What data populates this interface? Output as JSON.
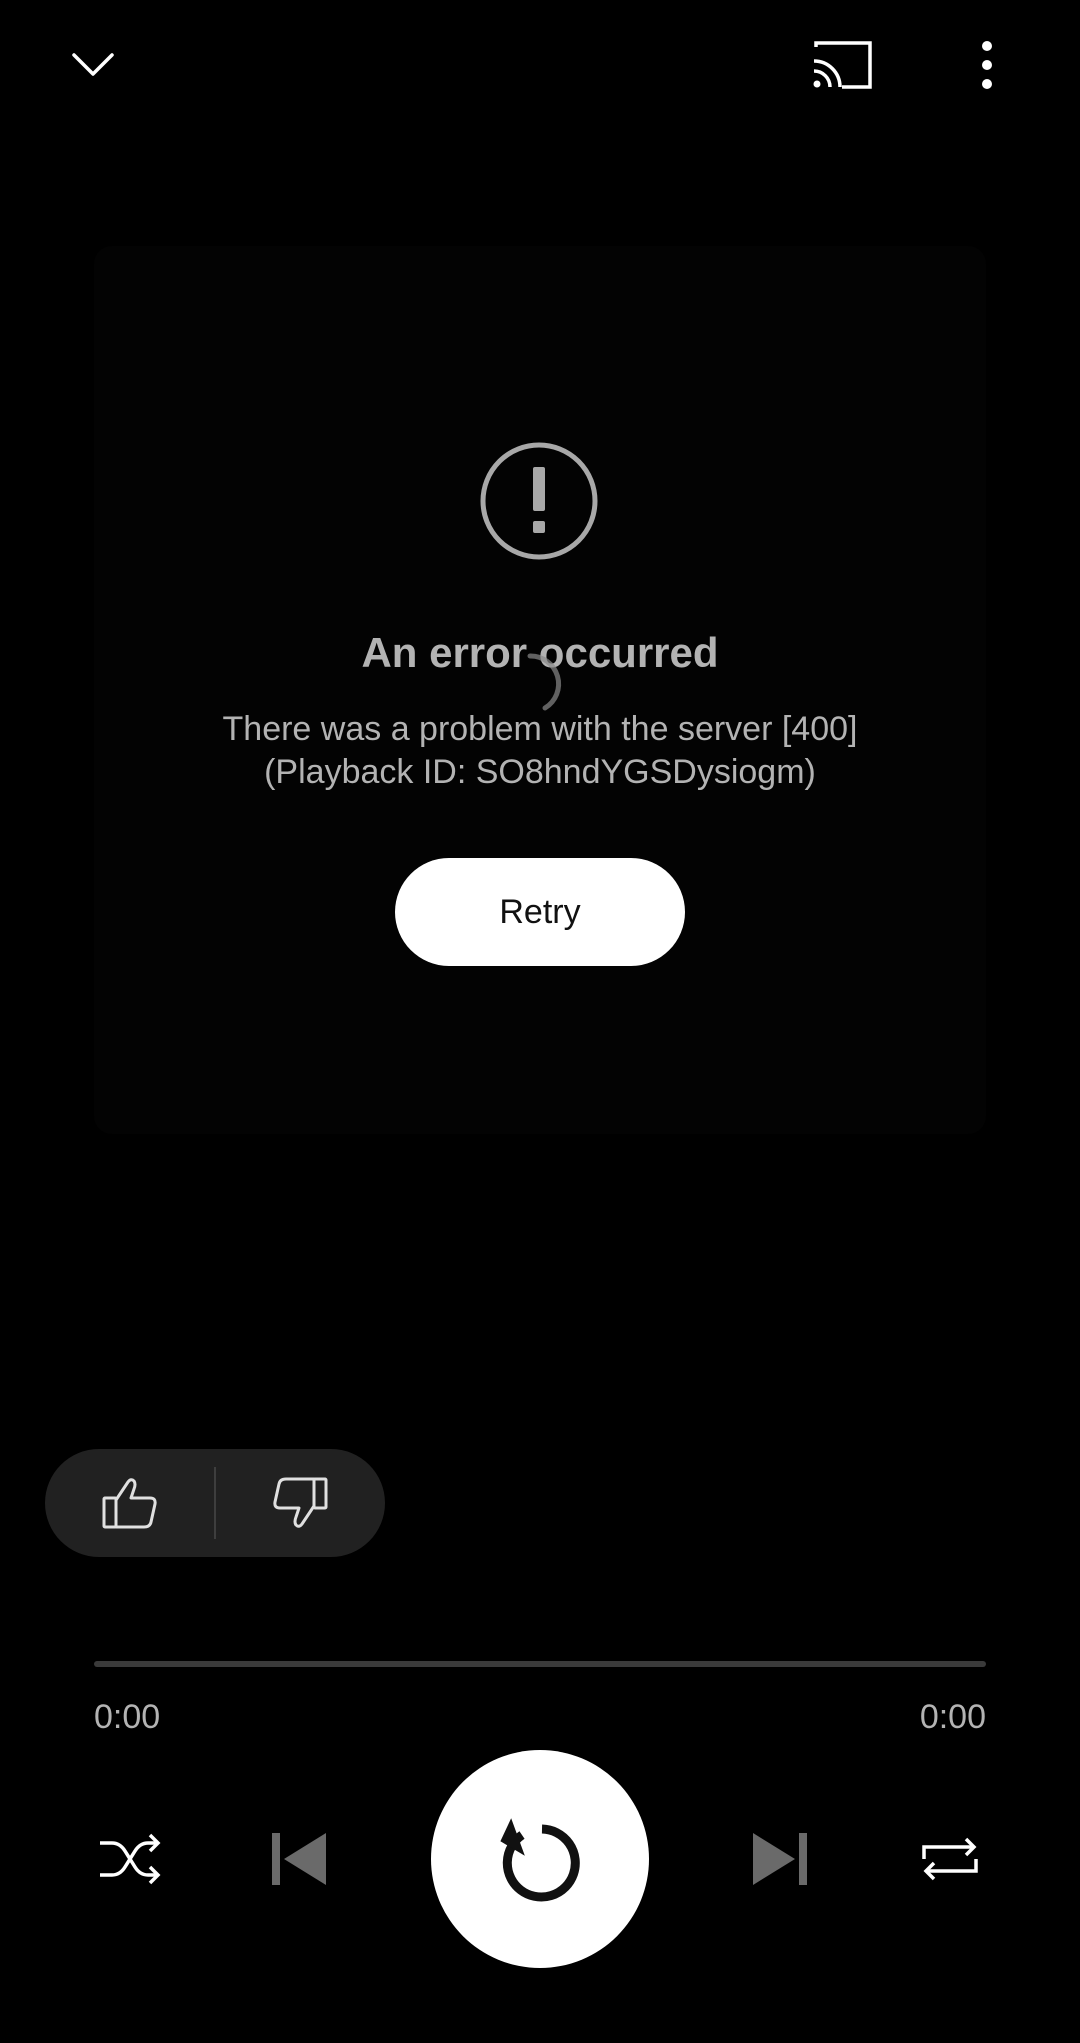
{
  "top_bar": {
    "collapse_icon": "chevron-down-icon",
    "cast_icon": "cast-icon",
    "more_icon": "more-vertical-icon"
  },
  "player": {
    "error_icon": "exclamation-circle-icon",
    "error_title": "An error occurred",
    "error_message_line1": "There was a problem with the server [400]",
    "error_message_line2": "(Playback ID: SO8hndYGSDysiogm)",
    "retry_label": "Retry"
  },
  "rating": {
    "like_icon": "thumbs-up-icon",
    "dislike_icon": "thumbs-down-icon"
  },
  "progress": {
    "elapsed": "0:00",
    "duration": "0:00",
    "fraction": 0
  },
  "controls": {
    "shuffle_icon": "shuffle-icon",
    "previous_icon": "skip-previous-icon",
    "replay_icon": "replay-icon",
    "next_icon": "skip-next-icon",
    "repeat_icon": "repeat-icon"
  },
  "colors": {
    "background": "#000000",
    "muted_text": "#b3b3b3",
    "button_bg": "#ffffff",
    "pill_bg": "#212121"
  }
}
